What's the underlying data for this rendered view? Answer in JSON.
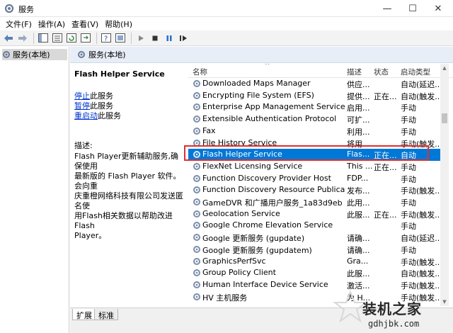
{
  "window": {
    "title": "服务",
    "minimize": "—",
    "maximize": "☐",
    "close": "✕"
  },
  "menu": [
    "文件(F)",
    "操作(A)",
    "查看(V)",
    "帮助(H)"
  ],
  "tree": {
    "item": "服务(本地)"
  },
  "pane": {
    "header": "服务(本地)"
  },
  "detail": {
    "service_name": "Flash Helper Service",
    "stop_link": "停止",
    "stop_suffix": "此服务",
    "pause_link": "暂停",
    "pause_suffix": "此服务",
    "restart_link": "重启动",
    "restart_suffix": "此服务",
    "desc_label": "描述:",
    "desc_lines": [
      "Flash Player更新辅助服务,确保使用",
      "最新版的 Flash Player 软件。会向重",
      "庆重橙网络科技有限公司发送匿名使",
      "用Flash相关数据以帮助改进 Flash",
      "Player。"
    ]
  },
  "columns": {
    "name": "名称",
    "desc": "描述",
    "status": "状态",
    "startup": "启动类型",
    "sort_arrow": "^"
  },
  "rows": [
    {
      "name": "Downloaded Maps Manager",
      "desc": "供应...",
      "status": "",
      "startup": "自动(延迟..."
    },
    {
      "name": "Encrypting File System (EFS)",
      "desc": "提供...",
      "status": "正在...",
      "startup": "自动(触发..."
    },
    {
      "name": "Enterprise App Management Service",
      "desc": "启用...",
      "status": "",
      "startup": "手动"
    },
    {
      "name": "Extensible Authentication Protocol",
      "desc": "可扩...",
      "status": "",
      "startup": "手动"
    },
    {
      "name": "Fax",
      "desc": "利用...",
      "status": "",
      "startup": "手动"
    },
    {
      "name": "File History Service",
      "desc": "将用...",
      "status": "",
      "startup": "手动(触发..."
    },
    {
      "name": "Flash Helper Service",
      "desc": "Flas...",
      "status": "正在...",
      "startup": "自动"
    },
    {
      "name": "FlexNet Licensing Service",
      "desc": "This ...",
      "status": "正在...",
      "startup": "手动"
    },
    {
      "name": "Function Discovery Provider Host",
      "desc": "FDP...",
      "status": "",
      "startup": "手动"
    },
    {
      "name": "Function Discovery Resource Publication",
      "desc": "发布...",
      "status": "",
      "startup": "手动(触发..."
    },
    {
      "name": "GameDVR 和广播用户服务_1a83d9eb",
      "desc": "此用...",
      "status": "",
      "startup": "手动"
    },
    {
      "name": "Geolocation Service",
      "desc": "此服...",
      "status": "正在...",
      "startup": "手动(触发..."
    },
    {
      "name": "Google Chrome Elevation Service",
      "desc": "",
      "status": "",
      "startup": "手动"
    },
    {
      "name": "Google 更新服务 (gupdate)",
      "desc": "请确...",
      "status": "",
      "startup": "自动(延迟..."
    },
    {
      "name": "Google 更新服务 (gupdatem)",
      "desc": "请确...",
      "status": "",
      "startup": "手动"
    },
    {
      "name": "GraphicsPerfSvc",
      "desc": "Gra...",
      "status": "",
      "startup": "手动(触发..."
    },
    {
      "name": "Group Policy Client",
      "desc": "此服...",
      "status": "",
      "startup": "自动(触发..."
    },
    {
      "name": "Human Interface Device Service",
      "desc": "激活...",
      "status": "",
      "startup": "手动(触发..."
    },
    {
      "name": "HV 主机服务",
      "desc": "为 H...",
      "status": "",
      "startup": "手动(触发..."
    }
  ],
  "selected_row": 6,
  "tabs": [
    "扩展",
    "标准"
  ],
  "watermark": {
    "brand": "装机之家",
    "url": "gdhjbk.com"
  },
  "colors": {
    "selection": "#0078d7",
    "link": "#0033cc",
    "highlight_box": "#e03030"
  }
}
